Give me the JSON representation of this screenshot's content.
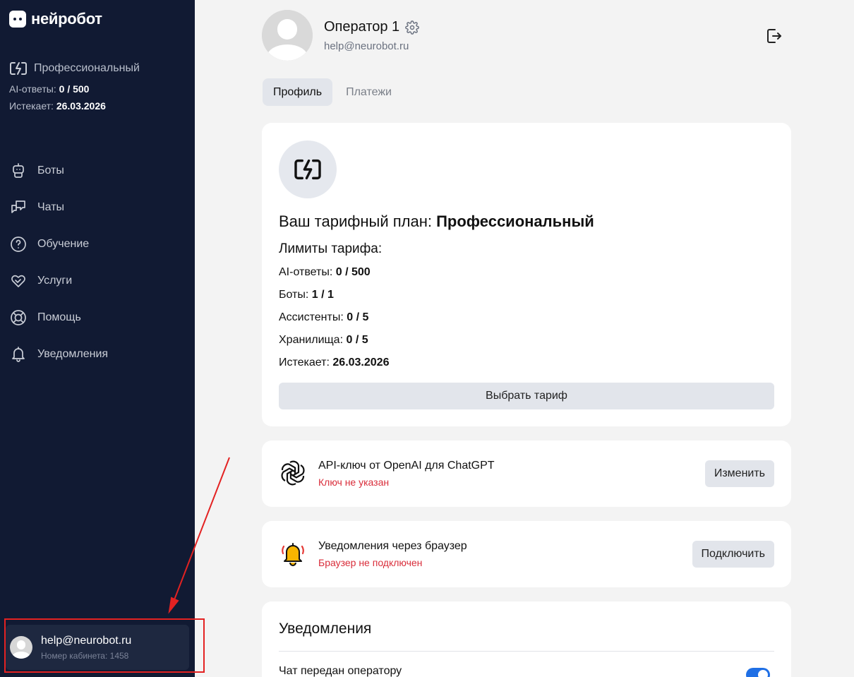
{
  "sidebar": {
    "logo_text": "нейробот",
    "plan": {
      "name": "Профессиональный",
      "ai_label": "AI-ответы:",
      "ai_value": "0 / 500",
      "expires_label": "Истекает:",
      "expires_value": "26.03.2026"
    },
    "nav": [
      {
        "label": "Боты",
        "icon": "robot-icon"
      },
      {
        "label": "Чаты",
        "icon": "chat-icon"
      },
      {
        "label": "Обучение",
        "icon": "question-icon"
      },
      {
        "label": "Услуги",
        "icon": "handshake-icon"
      },
      {
        "label": "Помощь",
        "icon": "lifebuoy-icon"
      },
      {
        "label": "Уведомления",
        "icon": "bell-icon"
      }
    ],
    "user": {
      "email": "help@neurobot.ru",
      "cabinet": "Номер кабинета: 1458"
    }
  },
  "profile": {
    "name": "Оператор 1",
    "email": "help@neurobot.ru"
  },
  "tabs": [
    {
      "label": "Профиль",
      "active": true
    },
    {
      "label": "Платежи",
      "active": false
    }
  ],
  "plan_card": {
    "title_prefix": "Ваш тарифный план:",
    "title_plan": "Профессиональный",
    "limits_title": "Лимиты тарифа:",
    "limits": [
      {
        "label": "AI-ответы:",
        "value": "0 / 500"
      },
      {
        "label": "Боты:",
        "value": "1 / 1"
      },
      {
        "label": "Ассистенты:",
        "value": "0 / 5"
      },
      {
        "label": "Хранилища:",
        "value": "0 / 5"
      },
      {
        "label": "Истекает:",
        "value": "26.03.2026"
      }
    ],
    "button": "Выбрать тариф"
  },
  "openai_card": {
    "title": "API-ключ от OpenAI для ChatGPT",
    "status": "Ключ не указан",
    "button": "Изменить"
  },
  "browser_card": {
    "title": "Уведомления через браузер",
    "status": "Браузер не подключен",
    "button": "Подключить"
  },
  "notifications_card": {
    "title": "Уведомления",
    "item": "Чат передан оператору",
    "item_enabled": true
  },
  "colors": {
    "sidebar_bg": "#111a33",
    "status_red": "#d92d3a",
    "toggle_blue": "#1f6fe5",
    "annotation_red": "#e32222"
  }
}
